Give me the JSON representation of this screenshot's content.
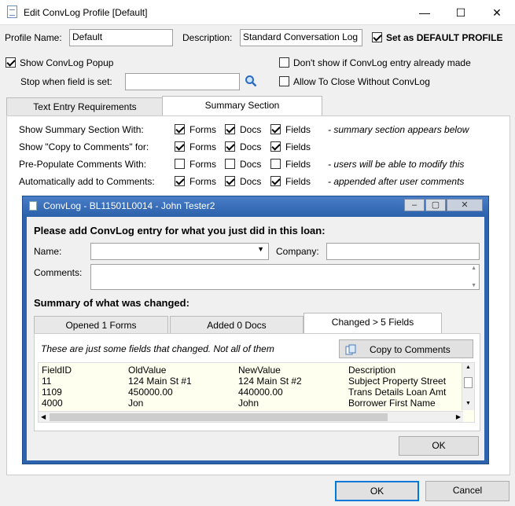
{
  "window": {
    "title": "Edit ConvLog Profile [Default]",
    "min": "—",
    "max": "☐",
    "close": "✕"
  },
  "profile": {
    "name_label": "Profile Name:",
    "name_value": "Default",
    "desc_label": "Description:",
    "desc_value": "Standard Conversation Log",
    "default_label": "Set as DEFAULT PROFILE",
    "default_checked": true
  },
  "options": {
    "show_popup": "Show ConvLog Popup",
    "stop_when": "Stop when field is set:",
    "dont_show": "Don't show if ConvLog entry already made",
    "allow_close": "Allow To Close Without ConvLog"
  },
  "tabs": [
    {
      "label": "Text Entry Requirements"
    },
    {
      "label": "Summary Section"
    }
  ],
  "summary_rows": [
    {
      "label": "Show Summary Section With:",
      "forms": true,
      "docs": true,
      "fields": true,
      "note": "- summary section appears below"
    },
    {
      "label": "Show \"Copy to Comments\" for:",
      "forms": true,
      "docs": true,
      "fields": true,
      "note": ""
    },
    {
      "label": "Pre-Populate Comments With:",
      "forms": false,
      "docs": false,
      "fields": false,
      "note": "- users will be able to modify this"
    },
    {
      "label": "Automatically add to Comments:",
      "forms": true,
      "docs": true,
      "fields": true,
      "note": "- appended after user comments"
    }
  ],
  "check_labels": {
    "forms": "Forms",
    "docs": "Docs",
    "fields": "Fields"
  },
  "inner": {
    "title": "ConvLog - BL11501L0014 - John Tester2",
    "heading": "Please add ConvLog entry for what you just did in this loan:",
    "name_label": "Name:",
    "company_label": "Company:",
    "comments_label": "Comments:",
    "summary_heading": "Summary of what was changed:",
    "tabs": [
      {
        "label": "Opened 1 Forms"
      },
      {
        "label": "Added 0 Docs"
      },
      {
        "label": "Changed > 5 Fields"
      }
    ],
    "note": "These are just some fields that changed.  Not all of them",
    "copy_button": "Copy to Comments",
    "ok": "OK",
    "table": {
      "headers": [
        "FieldID",
        "OldValue",
        "NewValue",
        "Description"
      ],
      "rows": [
        [
          "11",
          "124 Main St #1",
          "124 Main St #2",
          "Subject Property Street"
        ],
        [
          "1109",
          "450000.00",
          "440000.00",
          "Trans Details Loan Amt"
        ],
        [
          "4000",
          "Jon",
          "John",
          "Borrower First Name"
        ]
      ]
    }
  },
  "footer": {
    "ok": "OK",
    "cancel": "Cancel"
  },
  "colors": {
    "accent": "#0078d7",
    "inner_title": "#2d62ad",
    "table_bg": "#fffff0"
  }
}
